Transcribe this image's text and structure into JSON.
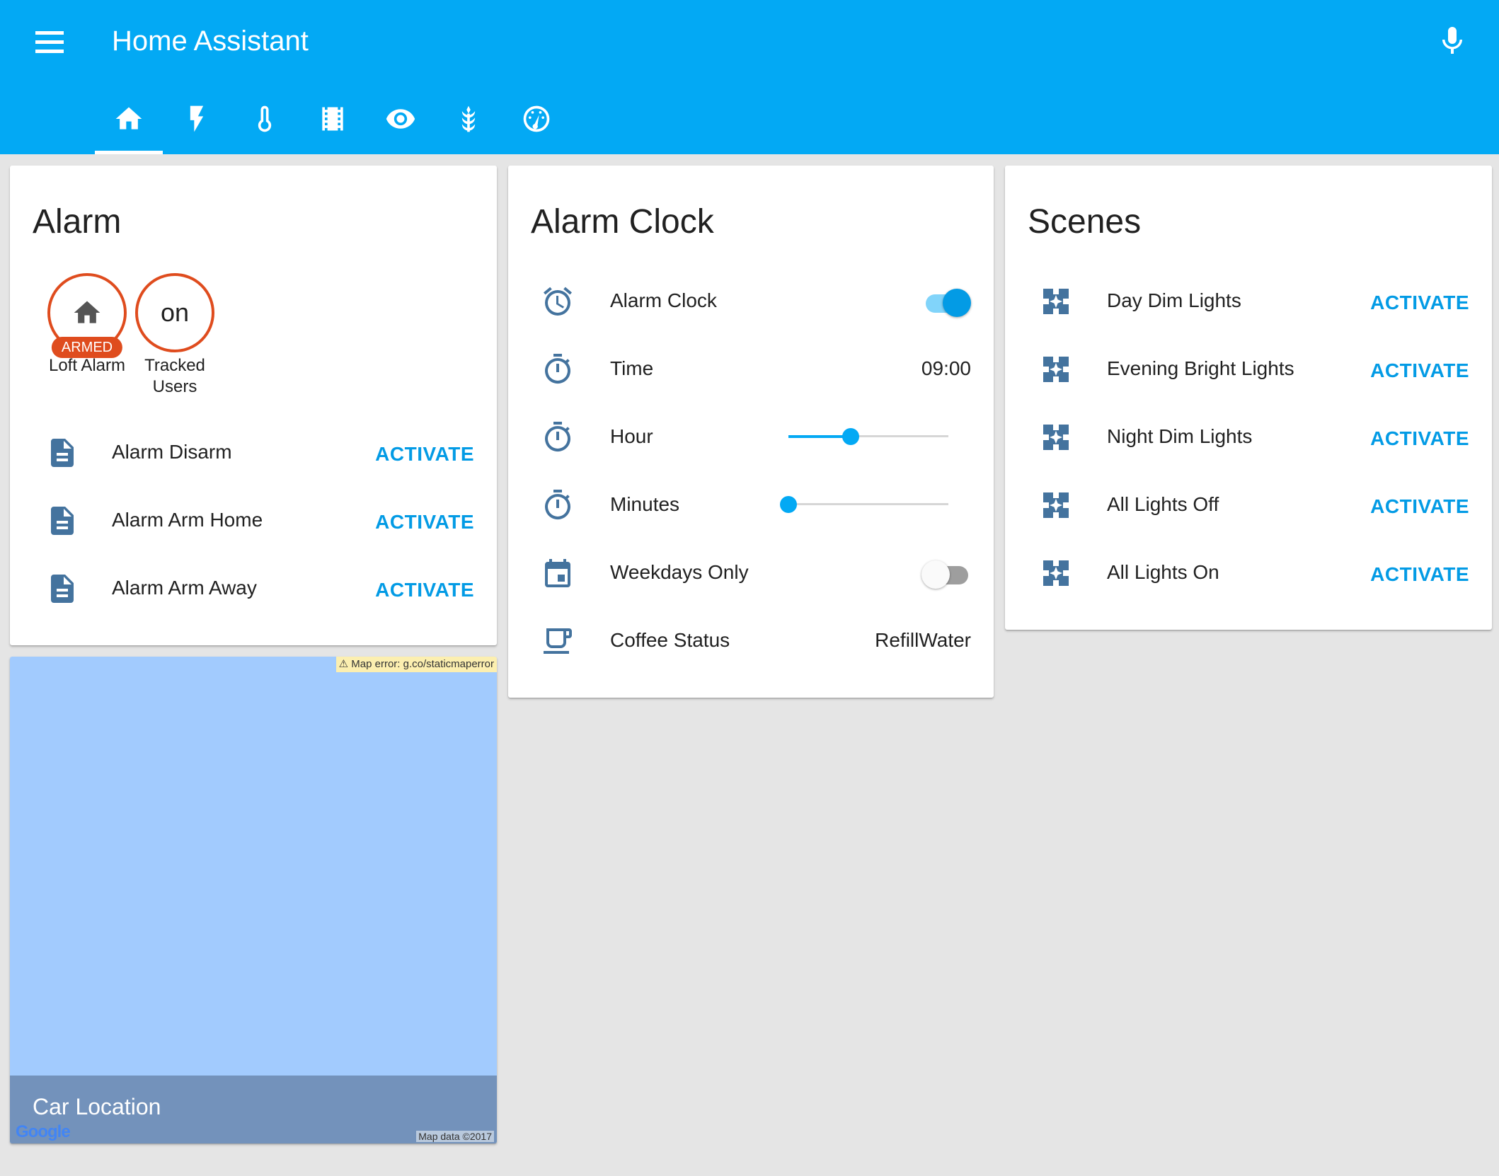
{
  "header": {
    "title": "Home Assistant",
    "menu_icon": "menu-icon",
    "mic_icon": "microphone-icon"
  },
  "tabs": [
    {
      "icon": "home-icon",
      "active": true
    },
    {
      "icon": "flash-icon",
      "active": false
    },
    {
      "icon": "thermometer-icon",
      "active": false
    },
    {
      "icon": "film-icon",
      "active": false
    },
    {
      "icon": "eye-icon",
      "active": false
    },
    {
      "icon": "plant-icon",
      "active": false
    },
    {
      "icon": "gauge-icon",
      "active": false
    }
  ],
  "alarm_card": {
    "title": "Alarm",
    "badges": [
      {
        "icon": "home-icon",
        "pill": "ARMED",
        "label": "Loft Alarm"
      },
      {
        "text": "on",
        "label": "Tracked Users"
      }
    ],
    "rows": [
      {
        "icon": "script-icon",
        "label": "Alarm Disarm",
        "action": "ACTIVATE"
      },
      {
        "icon": "script-icon",
        "label": "Alarm Arm Home",
        "action": "ACTIVATE"
      },
      {
        "icon": "script-icon",
        "label": "Alarm Arm Away",
        "action": "ACTIVATE"
      }
    ]
  },
  "alarm_clock_card": {
    "title": "Alarm Clock",
    "rows": [
      {
        "icon": "alarm-clock-icon",
        "label": "Alarm Clock",
        "control": "switch",
        "on": true
      },
      {
        "icon": "timer-icon",
        "label": "Time",
        "value": "09:00"
      },
      {
        "icon": "timer-icon",
        "label": "Hour",
        "control": "slider",
        "level": 0.39
      },
      {
        "icon": "timer-icon",
        "label": "Minutes",
        "control": "slider",
        "level": 0.0
      },
      {
        "icon": "calendar-icon",
        "label": "Weekdays Only",
        "control": "switch",
        "on": false
      },
      {
        "icon": "coffee-icon",
        "label": "Coffee Status",
        "value": "RefillWater"
      }
    ]
  },
  "scenes_card": {
    "title": "Scenes",
    "rows": [
      {
        "icon": "scene-icon",
        "label": "Day Dim Lights",
        "action": "ACTIVATE"
      },
      {
        "icon": "scene-icon",
        "label": "Evening Bright Lights",
        "action": "ACTIVATE"
      },
      {
        "icon": "scene-icon",
        "label": "Night Dim Lights",
        "action": "ACTIVATE"
      },
      {
        "icon": "scene-icon",
        "label": "All Lights Off",
        "action": "ACTIVATE"
      },
      {
        "icon": "scene-icon",
        "label": "All Lights On",
        "action": "ACTIVATE"
      }
    ]
  },
  "map_card": {
    "title": "Car Location",
    "error": "Map error: g.co/staticmaperror",
    "attribution": "Map data ©2017",
    "logo": "Google"
  },
  "colors": {
    "primary": "#03a9f4",
    "accent": "#039be5",
    "alarm_armed": "#df4c1e",
    "icon": "#44739e",
    "background": "#e5e5e5",
    "map_water": "#a2cbfe"
  }
}
